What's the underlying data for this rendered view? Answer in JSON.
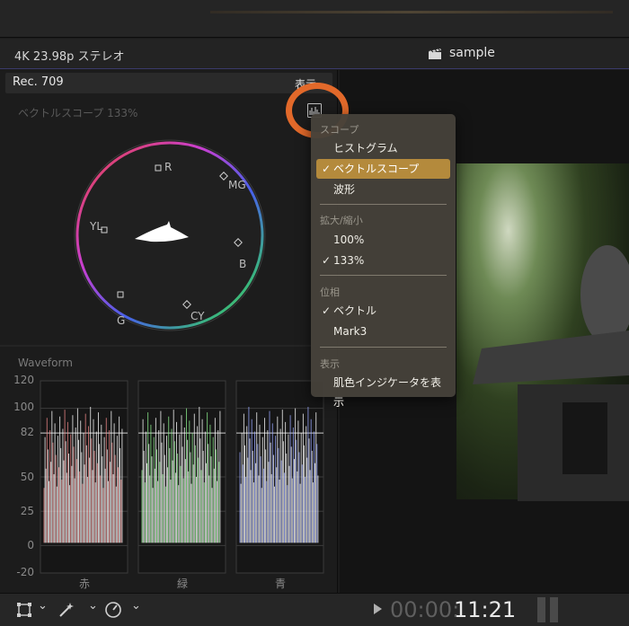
{
  "infobar": {
    "format": "4K 23.98p ステレオ",
    "title": "sample"
  },
  "scopes": {
    "preset": "Rec. 709",
    "show_label": "表示",
    "vectorscope_label": "ベクトルスコープ 133%",
    "vectorscope_targets": [
      "R",
      "MG",
      "YL",
      "B",
      "G",
      "CY"
    ],
    "waveform_label": "Waveform",
    "waveform_ticks": [
      "120",
      "100",
      "82",
      "50",
      "25",
      "0",
      "-20"
    ],
    "waveform_channels": [
      "赤",
      "緑",
      "青"
    ]
  },
  "menu": {
    "scope_header": "スコープ",
    "scope_items": [
      "ヒストグラム",
      "ベクトルスコープ",
      "波形"
    ],
    "zoom_header": "拡大/縮小",
    "zoom_items": [
      "100%",
      "133%"
    ],
    "phase_header": "位相",
    "phase_items": [
      "ベクトル",
      "Mark3"
    ],
    "display_header": "表示",
    "display_items": [
      "肌色インジケータを表示"
    ],
    "check": "✓"
  },
  "toolbar": {
    "timecode_dim": "00:00:",
    "timecode_main": "11:21",
    "chevron": "⌄"
  },
  "colors": {
    "accent": "#b48a3c",
    "highlight": "#e2692a"
  }
}
